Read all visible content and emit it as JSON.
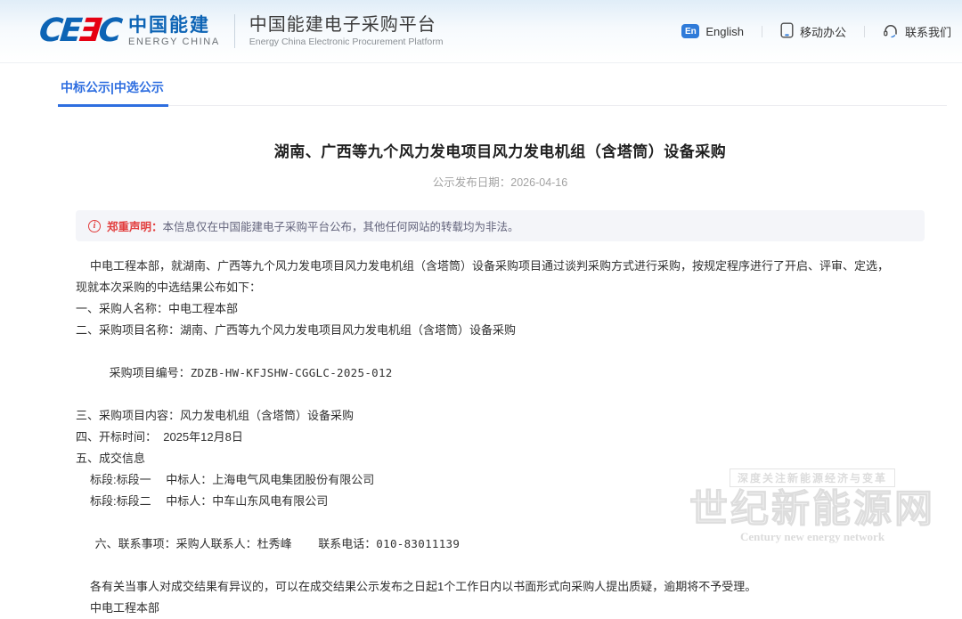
{
  "header": {
    "logo_letters": {
      "l1": "C",
      "l2": "E",
      "l3": "Ǝ",
      "l4": "C"
    },
    "brand_cn": "中国能建",
    "brand_en": "ENERGY CHINA",
    "platform_cn": "中国能建电子采购平台",
    "platform_en": "Energy China Electronic Procurement Platform",
    "en_badge": "En",
    "nav": {
      "english": "English",
      "mobile": "移动办公",
      "contact": "联系我们"
    }
  },
  "tabs": {
    "active": "中标公示|中选公示"
  },
  "doc": {
    "title": "湖南、广西等九个风力发电项目风力发电机组（含塔筒）设备采购",
    "publish_date": "公示发布日期：2026-04-16",
    "notice_icon": "i",
    "notice_label": "郑重声明：",
    "notice_text": "本信息仅在中国能建电子采购平台公布，其他任何网站的转载均为非法。",
    "intro_line1": "中电工程本部，就湖南、广西等九个风力发电项目风力发电机组（含塔筒）设备采购项目通过谈判采购方式进行采购，按规定程序进行了开启、评审、定选，",
    "intro_line2": "现就本次采购的中选结果公布如下：",
    "item1": "一、采购人名称：中电工程本部",
    "item2": "二、采购项目名称：湖南、广西等九个风力发电项目风力发电机组（含塔筒）设备采购",
    "item2_code_label": "采购项目编号：",
    "item2_code": "ZDZB-HW-KFJSHW-CGGLC-2025-012",
    "item3": "三、采购项目内容：风力发电机组（含塔筒）设备采购",
    "item4": "四、开标时间：  2025年12月8日",
    "item5": "五、成交信息",
    "lot1": "标段:标段一　 中标人：上海电气风电集团股份有限公司",
    "lot2": "标段:标段二　 中标人：中车山东风电有限公司",
    "item6": "六、联系事项：采购人联系人：杜秀峰　　 联系电话：",
    "item6_phone": "010-83011139",
    "closing": "各有关当事人对成交结果有异议的，可以在成交结果公示发布之日起1个工作日内以书面形式向采购人提出质疑，逾期将不予受理。",
    "signature": "中电工程本部"
  },
  "watermark": {
    "tag": "深度关注新能源经济与变革",
    "big": "世纪新能源网",
    "en": "Century new energy network"
  }
}
